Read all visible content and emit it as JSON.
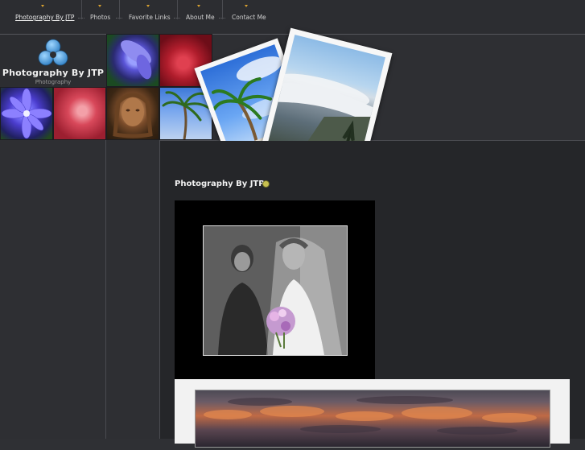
{
  "nav": {
    "items": [
      {
        "label": "Photography By JTP",
        "active": true
      },
      {
        "label": "Photos",
        "active": false
      },
      {
        "label": "Favorite Links",
        "active": false
      },
      {
        "label": "About Me",
        "active": false
      },
      {
        "label": "Contact Me",
        "active": false
      }
    ]
  },
  "logo": {
    "title": "Photography By JTP",
    "subtitle": "Photography",
    "icon": "trefoil-icon"
  },
  "post": {
    "title": "Photography By JTP"
  },
  "colors": {
    "accent": "#d8a030",
    "logo_blue": "#4aa3e0",
    "background": "#2f3034",
    "main_background": "#252629"
  }
}
